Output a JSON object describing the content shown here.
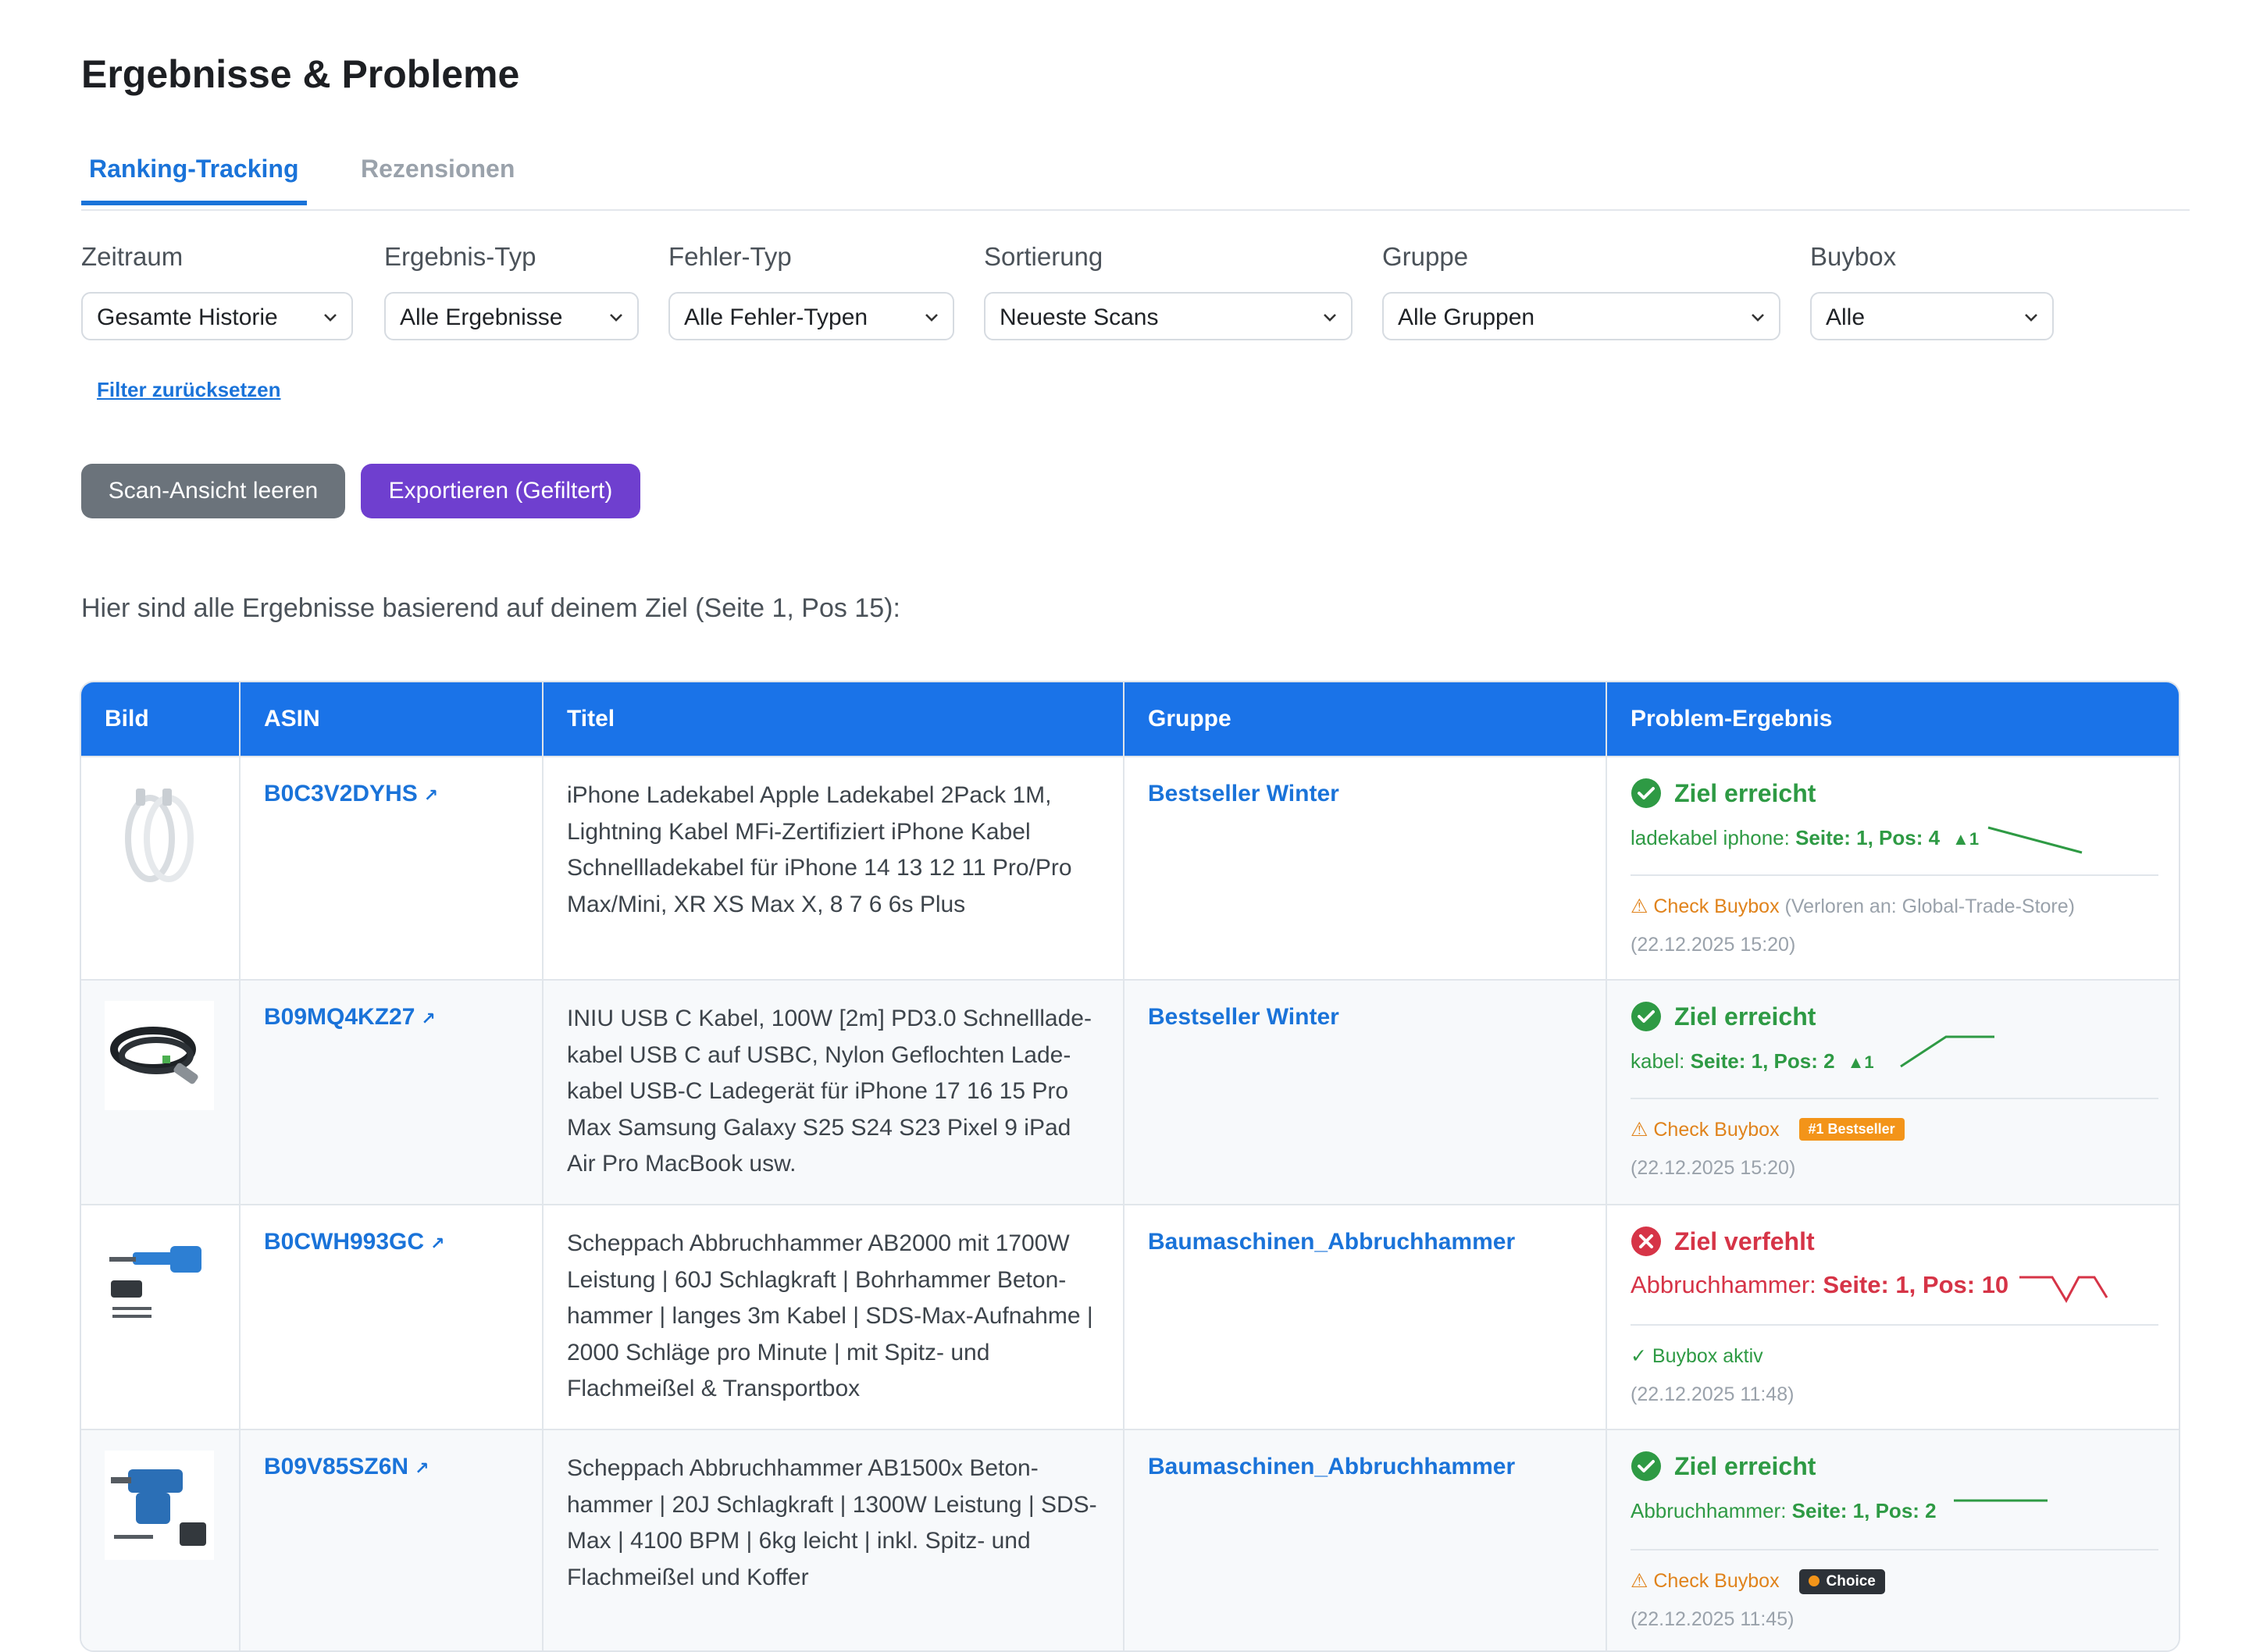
{
  "page": {
    "title": "Ergebnisse & Probleme",
    "intro": "Hier sind alle Ergebnisse basierend auf deinem Ziel (Seite 1, Pos 15):"
  },
  "tabs": [
    "Ranking-Tracking",
    "Rezensionen"
  ],
  "filters": [
    {
      "label": "Zeitraum",
      "value": "Gesamte Historie"
    },
    {
      "label": "Ergebnis-Typ",
      "value": "Alle Ergebnisse"
    },
    {
      "label": "Fehler-Typ",
      "value": "Alle Fehler-Typen"
    },
    {
      "label": "Sortierung",
      "value": "Neueste Scans"
    },
    {
      "label": "Gruppe",
      "value": "Alle Gruppen"
    },
    {
      "label": "Buybox",
      "value": "Alle"
    }
  ],
  "reset_link": "Filter zurücksetzen",
  "buttons": {
    "clear": "Scan-Ansicht leeren",
    "export": "Exportieren (Gefiltert)"
  },
  "table": {
    "headers": [
      "Bild",
      "ASIN",
      "Titel",
      "Gruppe",
      "Problem-Ergebnis"
    ],
    "rows": [
      {
        "asin": "B0C3V2DYHS",
        "title": "iPhone Ladekabel Apple Ladekabel 2Pack 1M, Lightning Kabel MFi-Zertifiziert iPhone Kabel Schnellladekabel für iPhone 14 13 12 11 Pro/Pro Max/Mini, XR XS Max X, 8 7 6 6s Plus",
        "group": "Bestseller Winter",
        "status": "Ziel erreicht",
        "keyword": "ladekabel iphone:",
        "position": "Seite: 1, Pos: 4",
        "delta": "▲1",
        "buybox": "Check Buybox",
        "buybox_note": "(Verloren an: Global-Trade-Store)",
        "timestamp": "(22.12.2025 15:20)"
      },
      {
        "asin": "B09MQ4KZ27",
        "title": "INIU USB C Kabel, 100W [2m] PD3.0 Schnelllade-kabel USB C auf USBC, Nylon Geflochten Lade-kabel USB-C Ladegerät für iPhone 17 16 15 Pro Max Samsung Galaxy S25 S24 S23 Pixel 9 iPad Air Pro MacBook usw.",
        "group": "Bestseller Winter",
        "status": "Ziel erreicht",
        "keyword": "kabel:",
        "position": "Seite: 1, Pos: 2",
        "delta": "▲1",
        "buybox": "Check Buybox",
        "badge": "#1 Bestseller",
        "timestamp": "(22.12.2025 15:20)"
      },
      {
        "asin": "B0CWH993GC",
        "title": "Scheppach Abbruchhammer AB2000 mit 1700W Leistung | 60J Schlagkraft | Bohrhammer Beton-hammer | langes 3m Kabel | SDS-Max-Aufnahme | 2000 Schläge pro Minute | mit Spitz- und Flachmeißel & Transportbox",
        "group": "Baumaschinen_Abbruchhammer",
        "status": "Ziel verfehlt",
        "keyword": "Abbruchhammer:",
        "position": "Seite: 1, Pos: 10",
        "buybox": "Buybox aktiv",
        "timestamp": "(22.12.2025 11:48)"
      },
      {
        "asin": "B09V85SZ6N",
        "title": "Scheppach Abbruchhammer AB1500x Beton-hammer | 20J Schlagkraft | 1300W Leistung | SDS-Max | 4100 BPM | 6kg leicht | inkl. Spitz- und Flachmeißel und Koffer",
        "group": "Baumaschinen_Abbruchhammer",
        "status": "Ziel erreicht",
        "keyword": "Abbruchhammer:",
        "position": "Seite: 1, Pos: 2",
        "buybox": "Check Buybox",
        "badge": "Choice",
        "timestamp": "(22.12.2025 11:45)"
      }
    ]
  },
  "colors": {
    "accent": "#1a73e8",
    "success": "#2e9a44",
    "error": "#d63447",
    "warning": "#e0831c",
    "export": "#6f3fcf",
    "clear": "#6b737b"
  }
}
